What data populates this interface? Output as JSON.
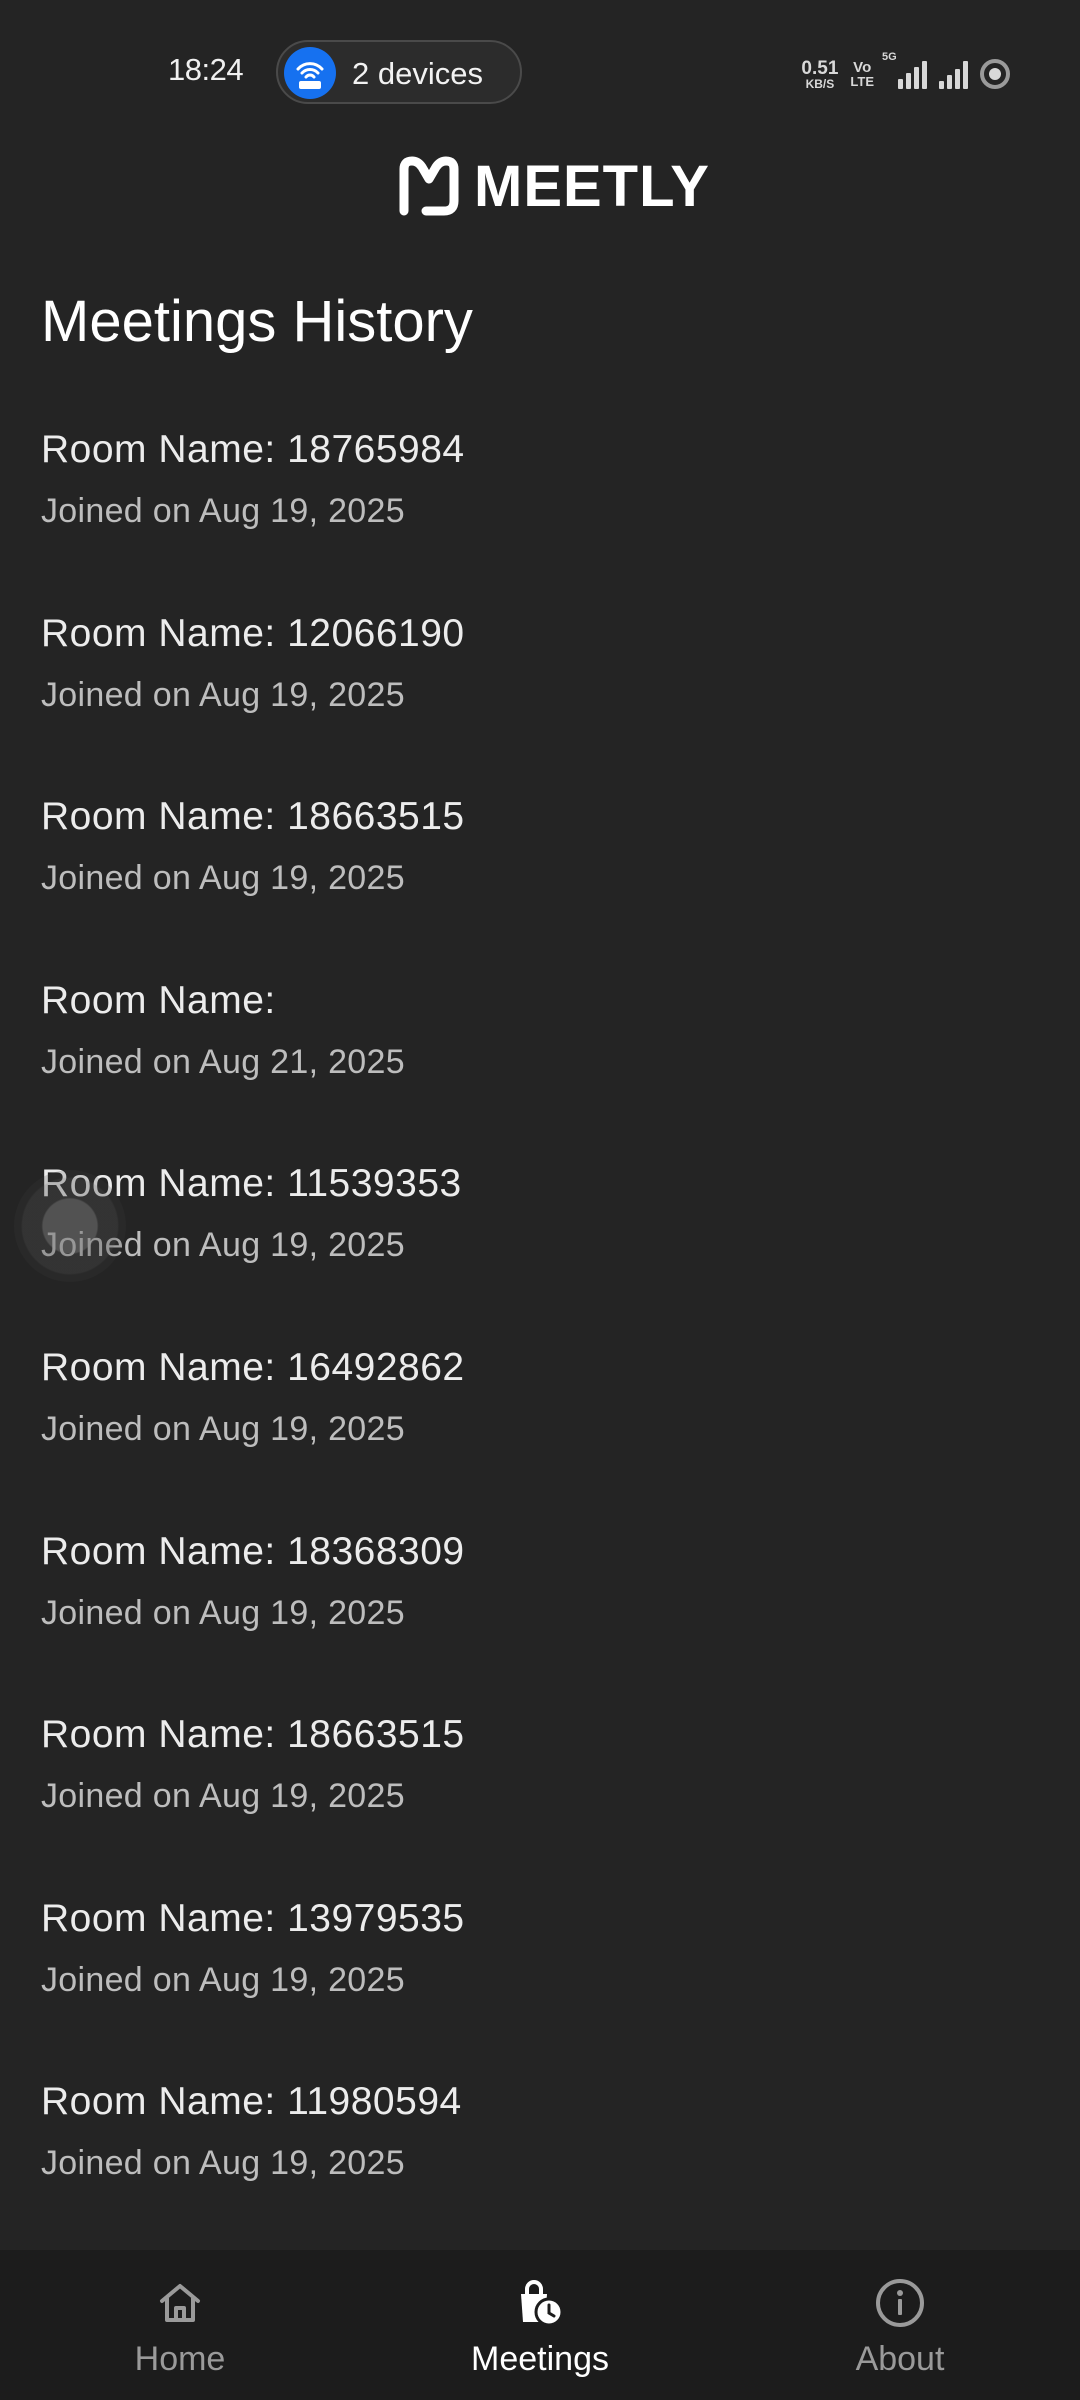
{
  "status_bar": {
    "time": "18:24",
    "hotspot_label": "2 devices",
    "net_speed_value": "0.51",
    "net_speed_unit": "KB/S",
    "volte_top": "Vo",
    "volte_bottom": "LTE",
    "network_tag": "5G"
  },
  "brand": {
    "logo_text": "MEETLY"
  },
  "page": {
    "title": "Meetings History"
  },
  "meetings": [
    {
      "room": "Room Name: 18765984",
      "joined": "Joined on Aug 19, 2025"
    },
    {
      "room": "Room Name: 12066190",
      "joined": "Joined on Aug 19, 2025"
    },
    {
      "room": "Room Name: 18663515",
      "joined": "Joined on Aug 19, 2025"
    },
    {
      "room": "Room Name:",
      "joined": "Joined on Aug 21, 2025"
    },
    {
      "room": "Room Name: 11539353",
      "joined": "Joined on Aug 19, 2025"
    },
    {
      "room": "Room Name: 16492862",
      "joined": "Joined on Aug 19, 2025"
    },
    {
      "room": "Room Name: 18368309",
      "joined": "Joined on Aug 19, 2025"
    },
    {
      "room": "Room Name: 18663515",
      "joined": "Joined on Aug 19, 2025"
    },
    {
      "room": "Room Name: 13979535",
      "joined": "Joined on Aug 19, 2025"
    },
    {
      "room": "Room Name: 11980594",
      "joined": "Joined on Aug 19, 2025"
    }
  ],
  "bottom_nav": {
    "items": [
      {
        "label": "Home",
        "icon": "home-icon",
        "active": false
      },
      {
        "label": "Meetings",
        "icon": "meetings-history-icon",
        "active": true
      },
      {
        "label": "About",
        "icon": "info-icon",
        "active": false
      }
    ]
  },
  "colors": {
    "background": "#242424",
    "nav_background": "#1c1c1c",
    "hotspot_accent": "#1671f0",
    "active_label": "#ffffff",
    "inactive_label": "#9a9a9a"
  }
}
